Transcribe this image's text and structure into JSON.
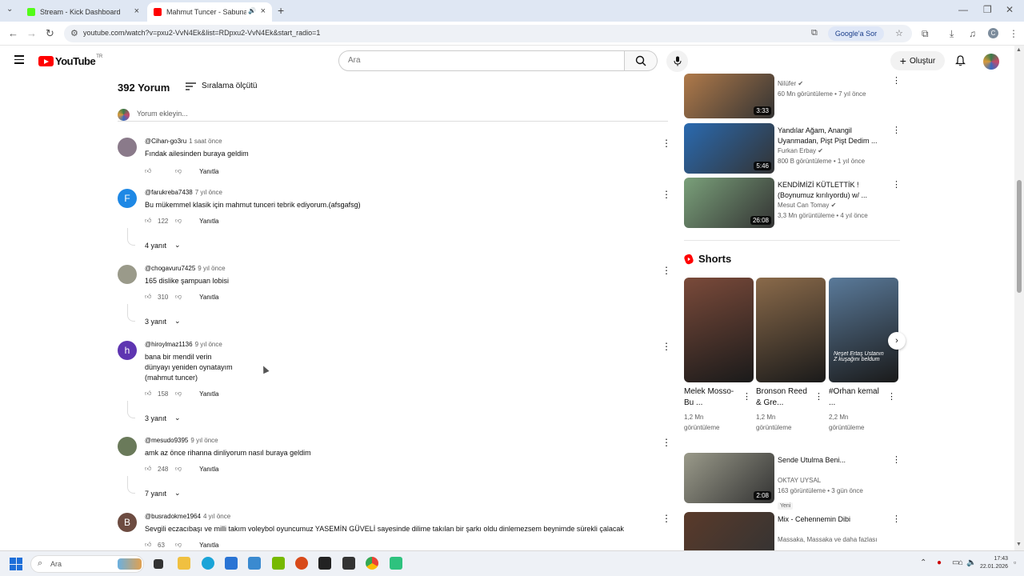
{
  "browser": {
    "tabs": [
      {
        "title": "Stream - Kick Dashboard",
        "active": false
      },
      {
        "title": "Mahmut Tuncer - Sabuna",
        "active": true
      }
    ],
    "url": "youtube.com/watch?v=pxu2-VvN4Ek&list=RDpxu2-VvN4Ek&start_radio=1",
    "google_search_label": "Google'a Sor"
  },
  "header": {
    "logo_text": "YouTube",
    "region": "TR",
    "search_placeholder": "Ara",
    "create_label": "Oluştur"
  },
  "comments": {
    "title": "392 Yorum",
    "sort_label": "Sıralama ölçütü",
    "add_placeholder": "Yorum ekleyin...",
    "reply_label": "Yanıtla",
    "items": [
      {
        "user": "@Cihan-go3ru",
        "time": "1 saat önce",
        "text": "Fındak ailesinden buraya geldim",
        "likes": "",
        "replies": "",
        "avatar_color": "#8a7a8a",
        "avatar_letter": ""
      },
      {
        "user": "@farukreba7438",
        "time": "7 yıl önce",
        "text": "Bu mükemmel klasik için mahmut tunceri tebrik ediyorum.(afsgafsg)",
        "likes": "122",
        "replies": "4 yanıt",
        "avatar_color": "#1e88e5",
        "avatar_letter": "F"
      },
      {
        "user": "@chogavuru7425",
        "time": "9 yıl önce",
        "text": "165 dislike şampuan lobisi",
        "likes": "310",
        "replies": "3 yanıt",
        "avatar_color": "#9a9a8a",
        "avatar_letter": ""
      },
      {
        "user": "@hiroylmaz1136",
        "time": "9 yıl önce",
        "text": "bana bir mendil verin\ndünyayı yeniden oynatayım\n(mahmut tuncer)",
        "likes": "158",
        "replies": "3 yanıt",
        "avatar_color": "#5e35b1",
        "avatar_letter": "h"
      },
      {
        "user": "@mesudo9395",
        "time": "9 yıl önce",
        "text": "amk az önce rihanna dinliyorum nasıl buraya geldim",
        "likes": "248",
        "replies": "7 yanıt",
        "avatar_color": "#6a7a5a",
        "avatar_letter": ""
      },
      {
        "user": "@busradokme1964",
        "time": "4 yıl önce",
        "text": "Sevgili eczacıbaşı ve milli takım voleybol oyuncumuz YASEMİN GÜVELİ sayesinde dilime takılan bir şarkı oldu dinlemezsem beynimde sürekli çalacak",
        "likes": "63",
        "replies": "",
        "avatar_color": "#6d4c41",
        "avatar_letter": "B"
      }
    ]
  },
  "sidebar": {
    "videos": [
      {
        "title": "",
        "channel": "Nilüfer",
        "views": "60 Mn görüntüleme • 7 yıl önce",
        "duration": "3:33",
        "thumb": "#b07a4a",
        "verified": true,
        "new": ""
      },
      {
        "title": "Yandılar Ağam, Anangil Uyanmadan, Pişt Pişt Dedim ...",
        "channel": "Furkan Erbay",
        "views": "800 B görüntüleme • 1 yıl önce",
        "duration": "5:46",
        "thumb": "#2a6ab0",
        "verified": true,
        "new": ""
      },
      {
        "title": "KENDİMİZİ KÜTLETTİK ! (Boynumuz kırılıyordu) w/ ...",
        "channel": "Mesut Can Tomay",
        "views": "3,3 Mn görüntüleme • 4 yıl önce",
        "duration": "26:08",
        "thumb": "#7aa07a",
        "verified": true,
        "new": ""
      },
      {
        "title": "Sende Utulma Beni...",
        "channel": "OKTAY UYSAL",
        "views": "163 görüntüleme • 3 gün önce",
        "duration": "2:08",
        "thumb": "#9a9a8a",
        "verified": false,
        "new": "Yeni"
      },
      {
        "title": "Mix - Cehennemin Dibi",
        "channel": "Massaka, Massaka ve daha fazlası",
        "views": "",
        "duration": "",
        "thumb": "#5a3a2a",
        "verified": false,
        "new": ""
      }
    ],
    "shorts_title": "Shorts",
    "shorts": [
      {
        "title": "Melek Mosso-Bu ...",
        "views": "1,2 Mn\ngörüntüleme",
        "thumb": "#7a4a3a"
      },
      {
        "title": "Bronson Reed & Gre...",
        "views": "1,2 Mn\ngörüntüleme",
        "thumb": "#8a6a4a"
      },
      {
        "title": "#Orhan kemal ...",
        "views": "2,2 Mn\ngörüntüleme",
        "thumb": "#5a7a9a"
      }
    ],
    "short_overlay_text": "Neşet Ertaş Ustanın\nZ kuşağını beldum"
  },
  "taskbar": {
    "search_placeholder": "Ara",
    "time": "17:43",
    "date": "22.01.2026"
  }
}
